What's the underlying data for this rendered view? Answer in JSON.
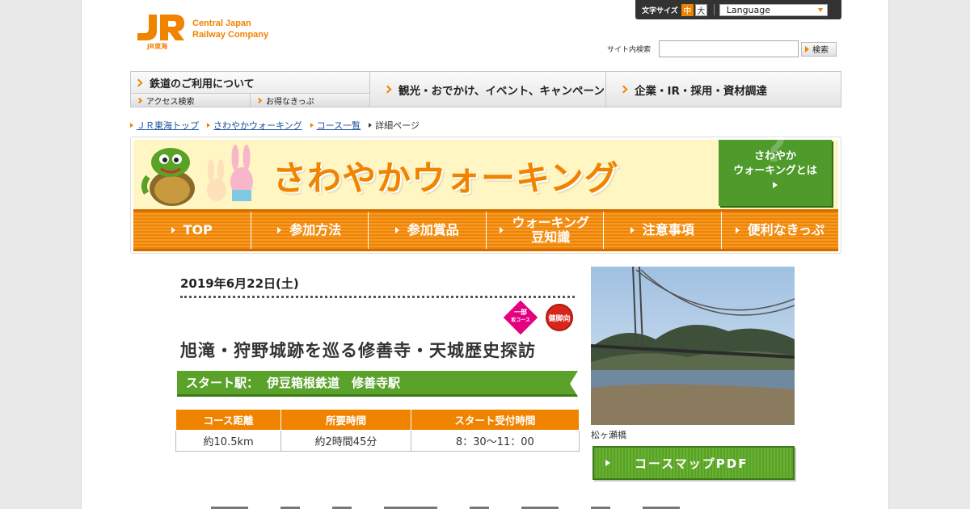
{
  "topbar": {
    "font_size_label": "文字サイズ",
    "font_mid": "中",
    "font_large": "大",
    "language": "Language"
  },
  "logo": {
    "mark": "JR",
    "line1": "Central Japan",
    "line2": "Railway Company",
    "sub": "JR東海",
    "color": "#f08300"
  },
  "search": {
    "label": "サイト内検索",
    "placeholder": "",
    "button": "検索"
  },
  "global_nav": {
    "main": "鉄道のご利用について",
    "subs": [
      "アクセス検索",
      "お得なきっぷ"
    ],
    "items": [
      "観光・おでかけ、イベント、キャンペーン",
      "企業・IR・採用・資材調達"
    ]
  },
  "breadcrumb": [
    "ＪＲ東海トップ",
    "さわやかウォーキング",
    "コース一覧",
    "詳細ページ"
  ],
  "banner": {
    "title": "さわやかウォーキング",
    "about_line1": "さわやか",
    "about_line2": "ウォーキングとは",
    "nav": [
      {
        "line1": "TOP",
        "line2": ""
      },
      {
        "line1": "参加方法",
        "line2": ""
      },
      {
        "line1": "参加賞品",
        "line2": ""
      },
      {
        "line1": "ウォーキング",
        "line2": "豆知識"
      },
      {
        "line1": "注意事項",
        "line2": ""
      },
      {
        "line1": "便利なきっぷ",
        "line2": ""
      }
    ]
  },
  "detail": {
    "date": "2019年6月22日(土)",
    "badge_partial_line1": "一部",
    "badge_partial_line2": "坂コース",
    "badge_level": "健脚向",
    "title": "旭滝・狩野城跡を巡る修善寺・天城歴史探訪",
    "start_label": "スタート駅：",
    "start_station": "伊豆箱根鉄道　修善寺駅",
    "table": {
      "headers": [
        "コース距離",
        "所要時間",
        "スタート受付時間"
      ],
      "values": [
        "約10.5km",
        "約2時間45分",
        "8：30～11：00"
      ]
    }
  },
  "photo": {
    "caption": "松ヶ瀬橋"
  },
  "pdf_button": "コースマップPDF"
}
